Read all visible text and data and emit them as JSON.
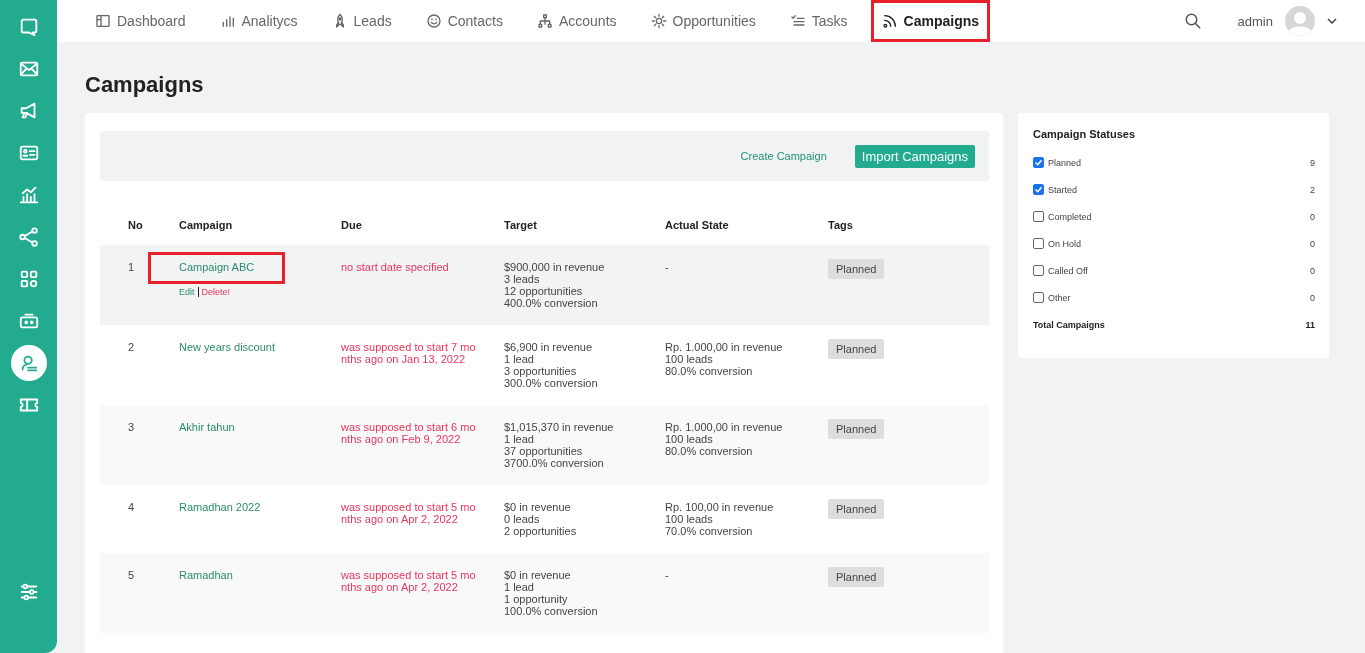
{
  "sidebar": {
    "items": [
      {
        "selected": false
      },
      {
        "selected": false
      },
      {
        "selected": false
      },
      {
        "selected": false
      },
      {
        "selected": false
      },
      {
        "selected": false
      },
      {
        "selected": false
      },
      {
        "selected": false
      },
      {
        "selected": true
      },
      {
        "selected": false
      }
    ]
  },
  "nav": {
    "tabs": [
      {
        "label": "Dashboard",
        "selected": false,
        "highlighted": false
      },
      {
        "label": "Analitycs",
        "selected": false,
        "highlighted": false
      },
      {
        "label": "Leads",
        "selected": false,
        "highlighted": false
      },
      {
        "label": "Contacts",
        "selected": false,
        "highlighted": false
      },
      {
        "label": "Accounts",
        "selected": false,
        "highlighted": false
      },
      {
        "label": "Opportunities",
        "selected": false,
        "highlighted": false
      },
      {
        "label": "Tasks",
        "selected": false,
        "highlighted": false
      },
      {
        "label": "Campaigns",
        "selected": true,
        "highlighted": true
      }
    ],
    "user": "admin"
  },
  "page_title": "Campaigns",
  "toolbar": {
    "link": "Create Campaign",
    "button": "Import Campaigns"
  },
  "table": {
    "columns": [
      "No",
      "Campaign",
      "Due",
      "Target",
      "Actual State",
      "Tags"
    ],
    "rows": [
      {
        "no": "1",
        "campaign": "Campaign ABC",
        "highlighted": true,
        "actions": [
          "Edit",
          "Delete!"
        ],
        "due": "no start date specified",
        "target": [
          "$900,000 in revenue",
          "3 leads",
          "12 opportunities",
          "400.0% conversion"
        ],
        "actual": [
          "-"
        ],
        "tag": "Planned"
      },
      {
        "no": "2",
        "campaign": "New years discount",
        "highlighted": false,
        "actions": [],
        "due": "was supposed to start 7 months ago on Jan 13, 2022",
        "target": [
          "$6,900 in revenue",
          "1 lead",
          "3 opportunities",
          "300.0% conversion"
        ],
        "actual": [
          "Rp. 1.000,00 in revenue",
          "100 leads",
          "80.0% conversion"
        ],
        "tag": "Planned"
      },
      {
        "no": "3",
        "campaign": "Akhir tahun",
        "highlighted": false,
        "actions": [],
        "due": "was supposed to start 6 months ago on Feb 9, 2022",
        "target": [
          "$1,015,370 in revenue",
          "1 lead",
          "37 opportunities",
          "3700.0% conversion"
        ],
        "actual": [
          "Rp. 1.000,00 in revenue",
          "100 leads",
          "80.0% conversion"
        ],
        "tag": "Planned"
      },
      {
        "no": "4",
        "campaign": "Ramadhan 2022",
        "highlighted": false,
        "actions": [],
        "due": "was supposed to start 5 months ago on Apr 2, 2022",
        "target": [
          "$0 in revenue",
          "0 leads",
          "2 opportunities"
        ],
        "actual": [
          "Rp. 100,00 in revenue",
          "100 leads",
          "70.0% conversion"
        ],
        "tag": "Planned"
      },
      {
        "no": "5",
        "campaign": "Ramadhan",
        "highlighted": false,
        "actions": [],
        "due": "was supposed to start 5 months ago on Apr 2, 2022",
        "target": [
          "$0 in revenue",
          "1 lead",
          "1 opportunity",
          "100.0% conversion"
        ],
        "actual": [
          "-"
        ],
        "tag": "Planned"
      }
    ]
  },
  "statuses": {
    "title": "Campaign Statuses",
    "items": [
      {
        "label": "Planned",
        "count": "9",
        "checked": true
      },
      {
        "label": "Started",
        "count": "2",
        "checked": true
      },
      {
        "label": "Completed",
        "count": "0",
        "checked": false
      },
      {
        "label": "On Hold",
        "count": "0",
        "checked": false
      },
      {
        "label": "Called Off",
        "count": "0",
        "checked": false
      },
      {
        "label": "Other",
        "count": "0",
        "checked": false
      }
    ],
    "total_label": "Total Campaigns",
    "total": "11"
  }
}
